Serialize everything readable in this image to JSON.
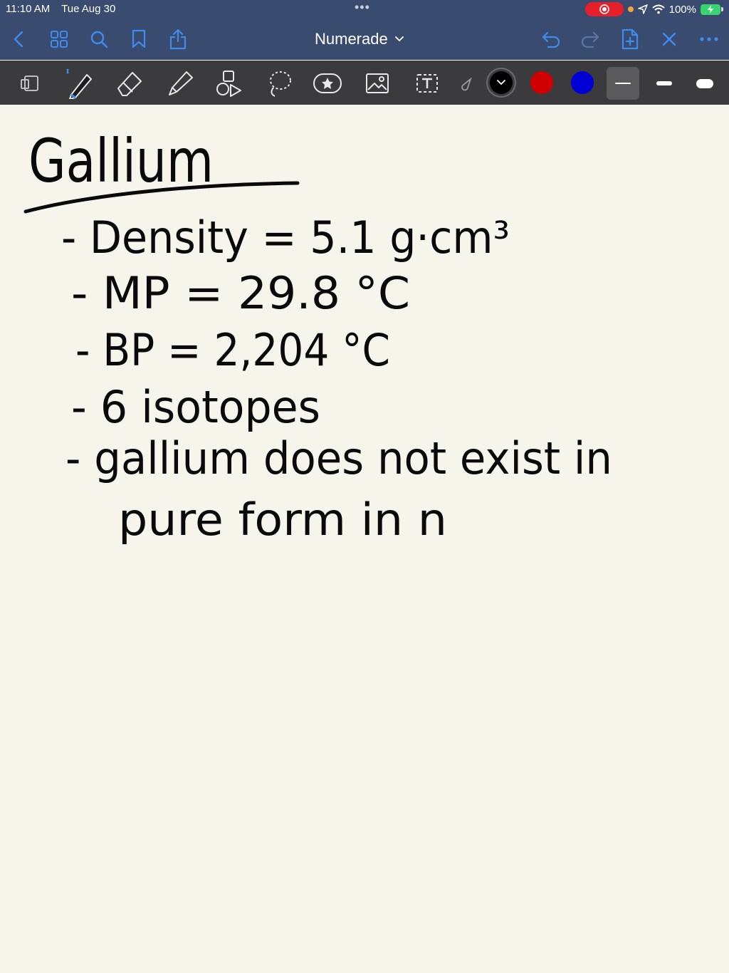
{
  "status_bar": {
    "time": "11:10 AM",
    "date": "Tue Aug 30",
    "battery": "100%",
    "icons": [
      "screen-record-icon",
      "location-arrow-icon",
      "wifi-icon",
      "battery-charging-icon"
    ]
  },
  "nav_bar": {
    "title": "Numerade",
    "left_icons": [
      "back-chevron-icon",
      "grid-icon",
      "search-icon",
      "bookmark-icon",
      "share-icon"
    ],
    "right_icons": [
      "undo-icon",
      "redo-icon",
      "add-page-icon",
      "close-icon",
      "more-icon"
    ]
  },
  "toolbar": {
    "tools": [
      "page-layout-icon",
      "pen-icon",
      "eraser-icon",
      "highlighter-icon",
      "shapes-icon",
      "lasso-icon",
      "sticker-icon",
      "image-icon",
      "text-icon",
      "laser-pointer-icon"
    ],
    "colors": [
      "#000000",
      "#d00000",
      "#0000d4"
    ],
    "selected_color_index": 0,
    "stroke_widths": [
      "thin",
      "medium",
      "thick"
    ],
    "selected_width_index": 0
  },
  "note": {
    "title": "Gallium",
    "lines": [
      "- Density = 5.1 g·cm³",
      "- MP = 29.8 °C",
      "- BP = 2,204 °C",
      "- 6 isotopes",
      "- gallium does not exist in",
      "pure form in n"
    ]
  }
}
